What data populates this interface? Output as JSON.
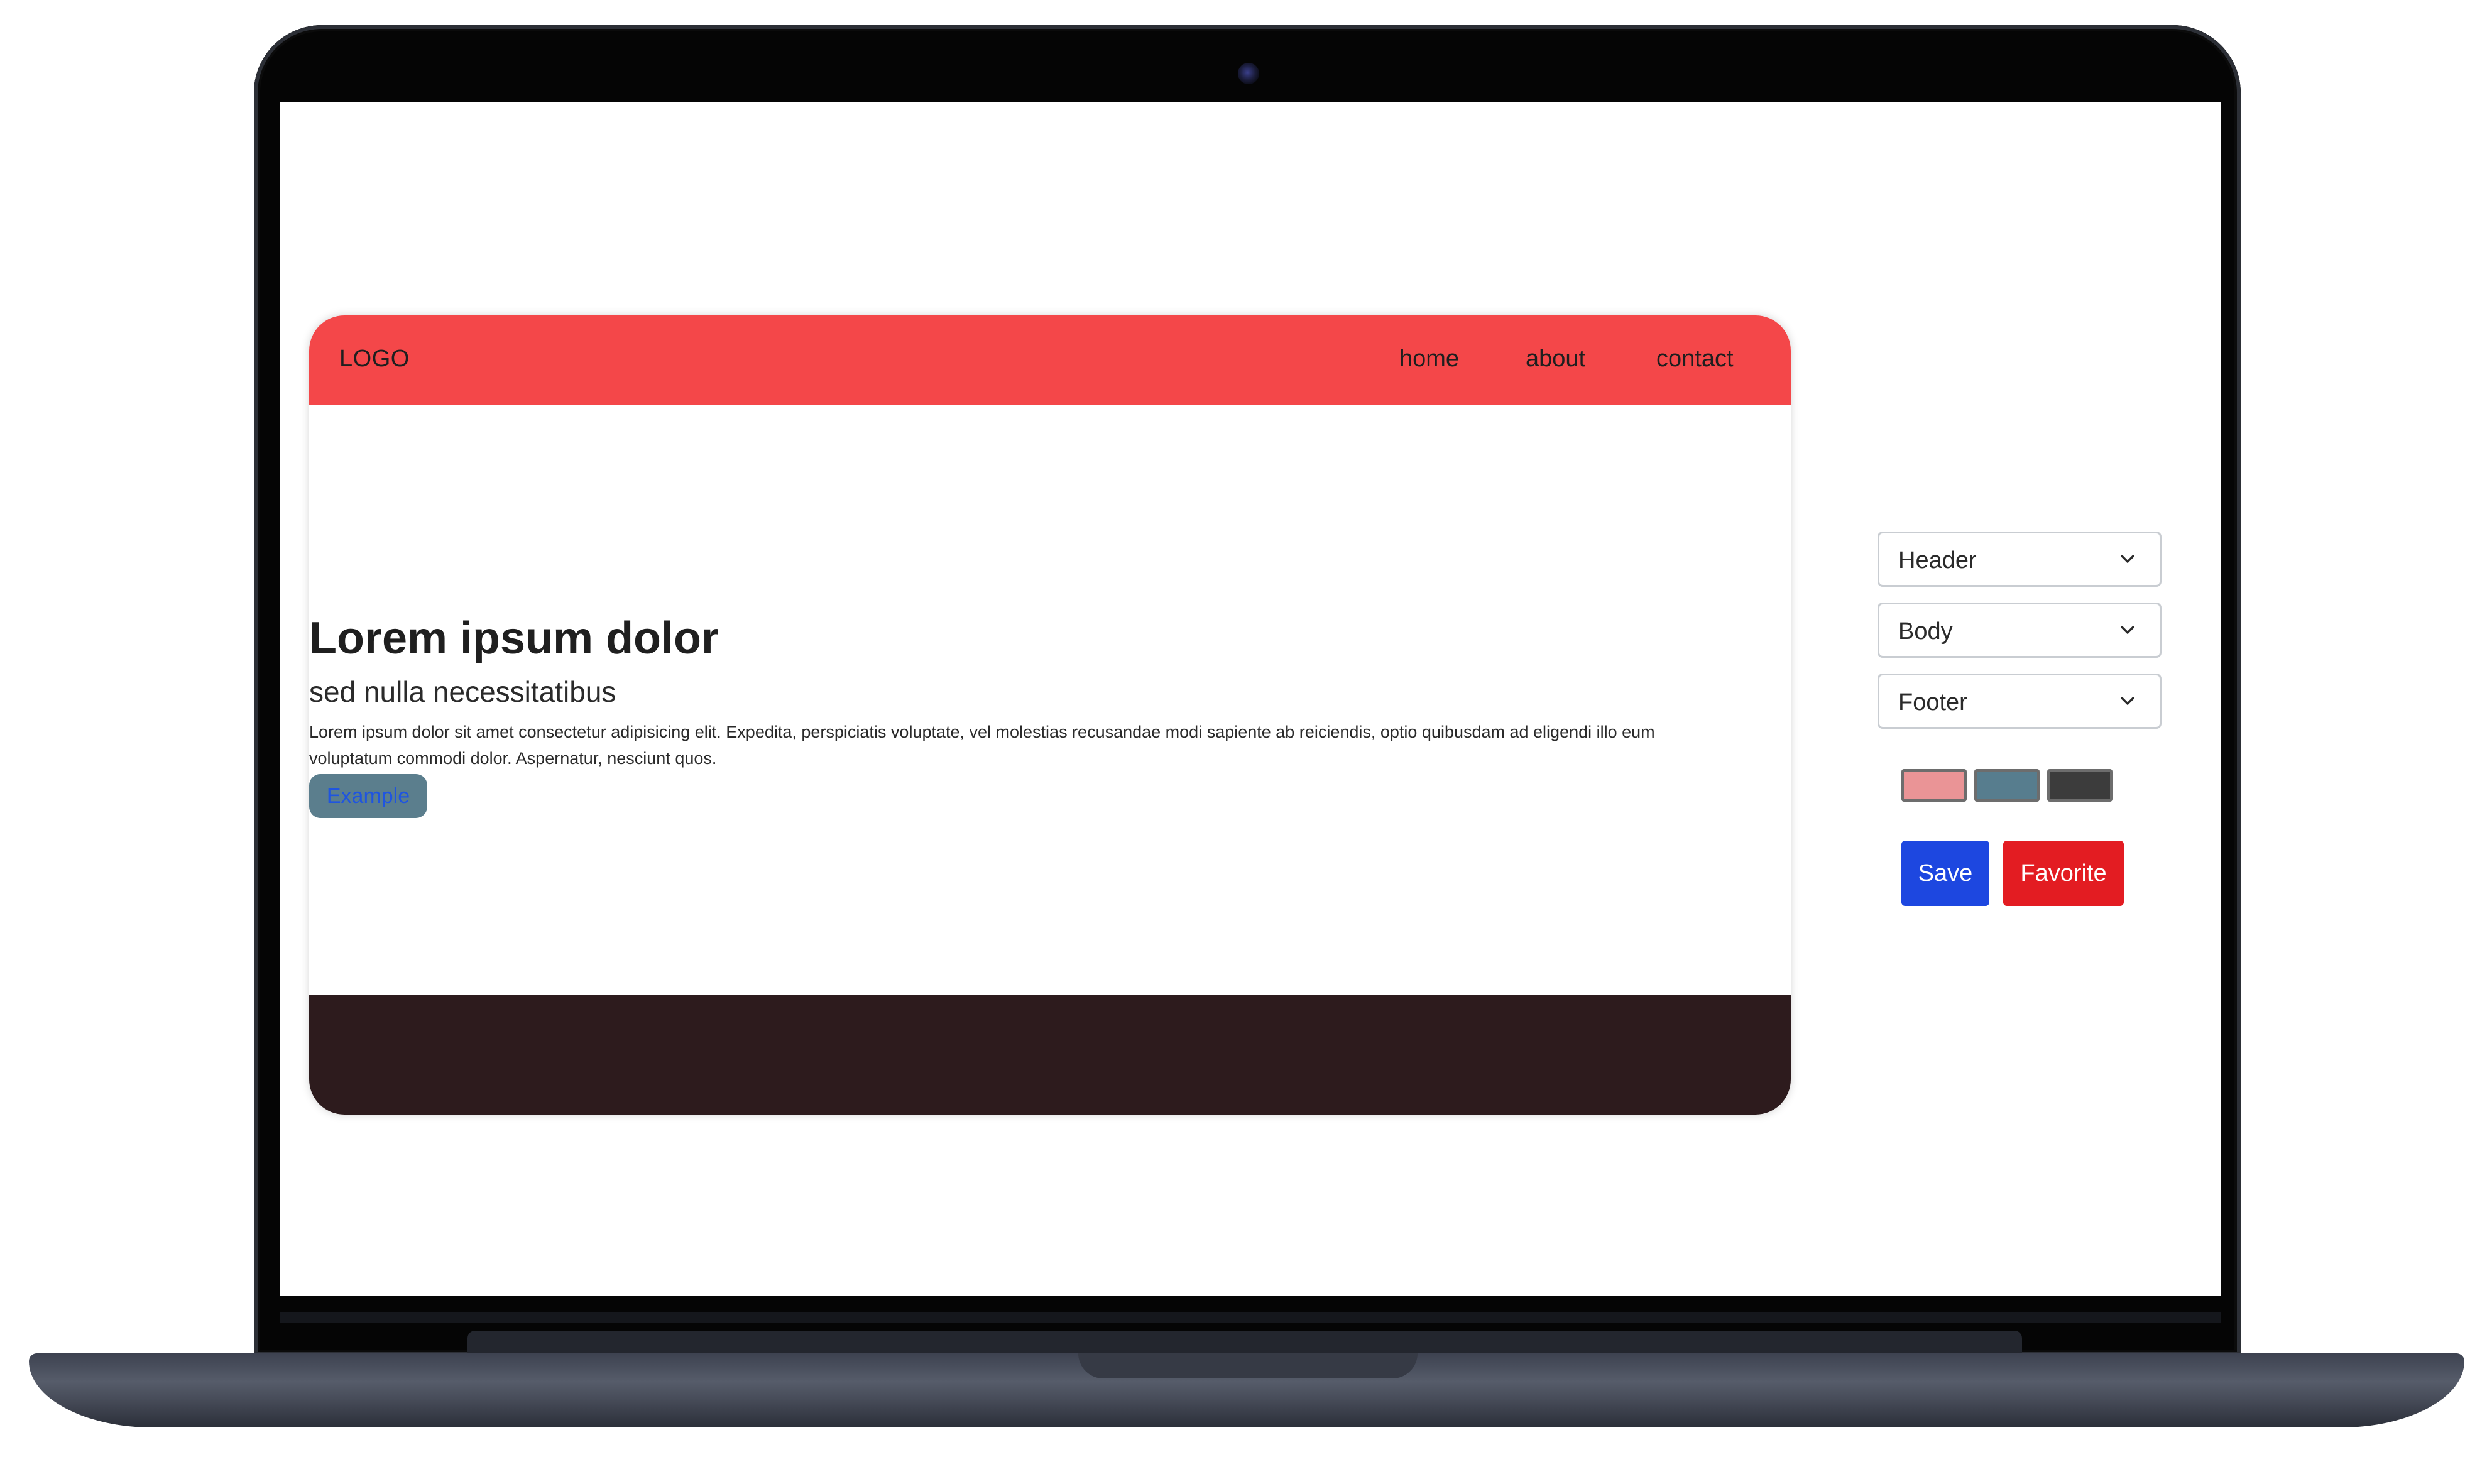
{
  "preview": {
    "header": {
      "logo": "LOGO",
      "nav": [
        "home",
        "about",
        "contact"
      ],
      "color": "#f44749"
    },
    "body": {
      "title": "Lorem ipsum dolor",
      "subtitle": "sed nulla necessitatibus",
      "paragraph": "Lorem ipsum dolor sit amet consectetur adipisicing elit. Expedita, perspiciatis voluptate, vel molestias recusandae modi sapiente ab reiciendis, optio quibusdam ad eligendi illo eum voluptatum commodi dolor. Aspernatur, nesciunt quos.",
      "button_label": "Example",
      "button_color": "#5b7e8d"
    },
    "footer": {
      "color": "#2d1b1d"
    }
  },
  "controls": {
    "selects": [
      {
        "value": "Header",
        "icon": "chevron-down-icon"
      },
      {
        "value": "Body",
        "icon": "chevron-down-icon"
      },
      {
        "value": "Footer",
        "icon": "chevron-down-icon"
      }
    ],
    "swatches": [
      {
        "name": "pink",
        "color": "#ea9496"
      },
      {
        "name": "slate-blue",
        "color": "#577d8e"
      },
      {
        "name": "dark-gray",
        "color": "#3c3c3c"
      }
    ],
    "save_label": "Save",
    "save_color": "#1d47e0",
    "favorite_label": "Favorite",
    "favorite_color": "#e31c22"
  }
}
